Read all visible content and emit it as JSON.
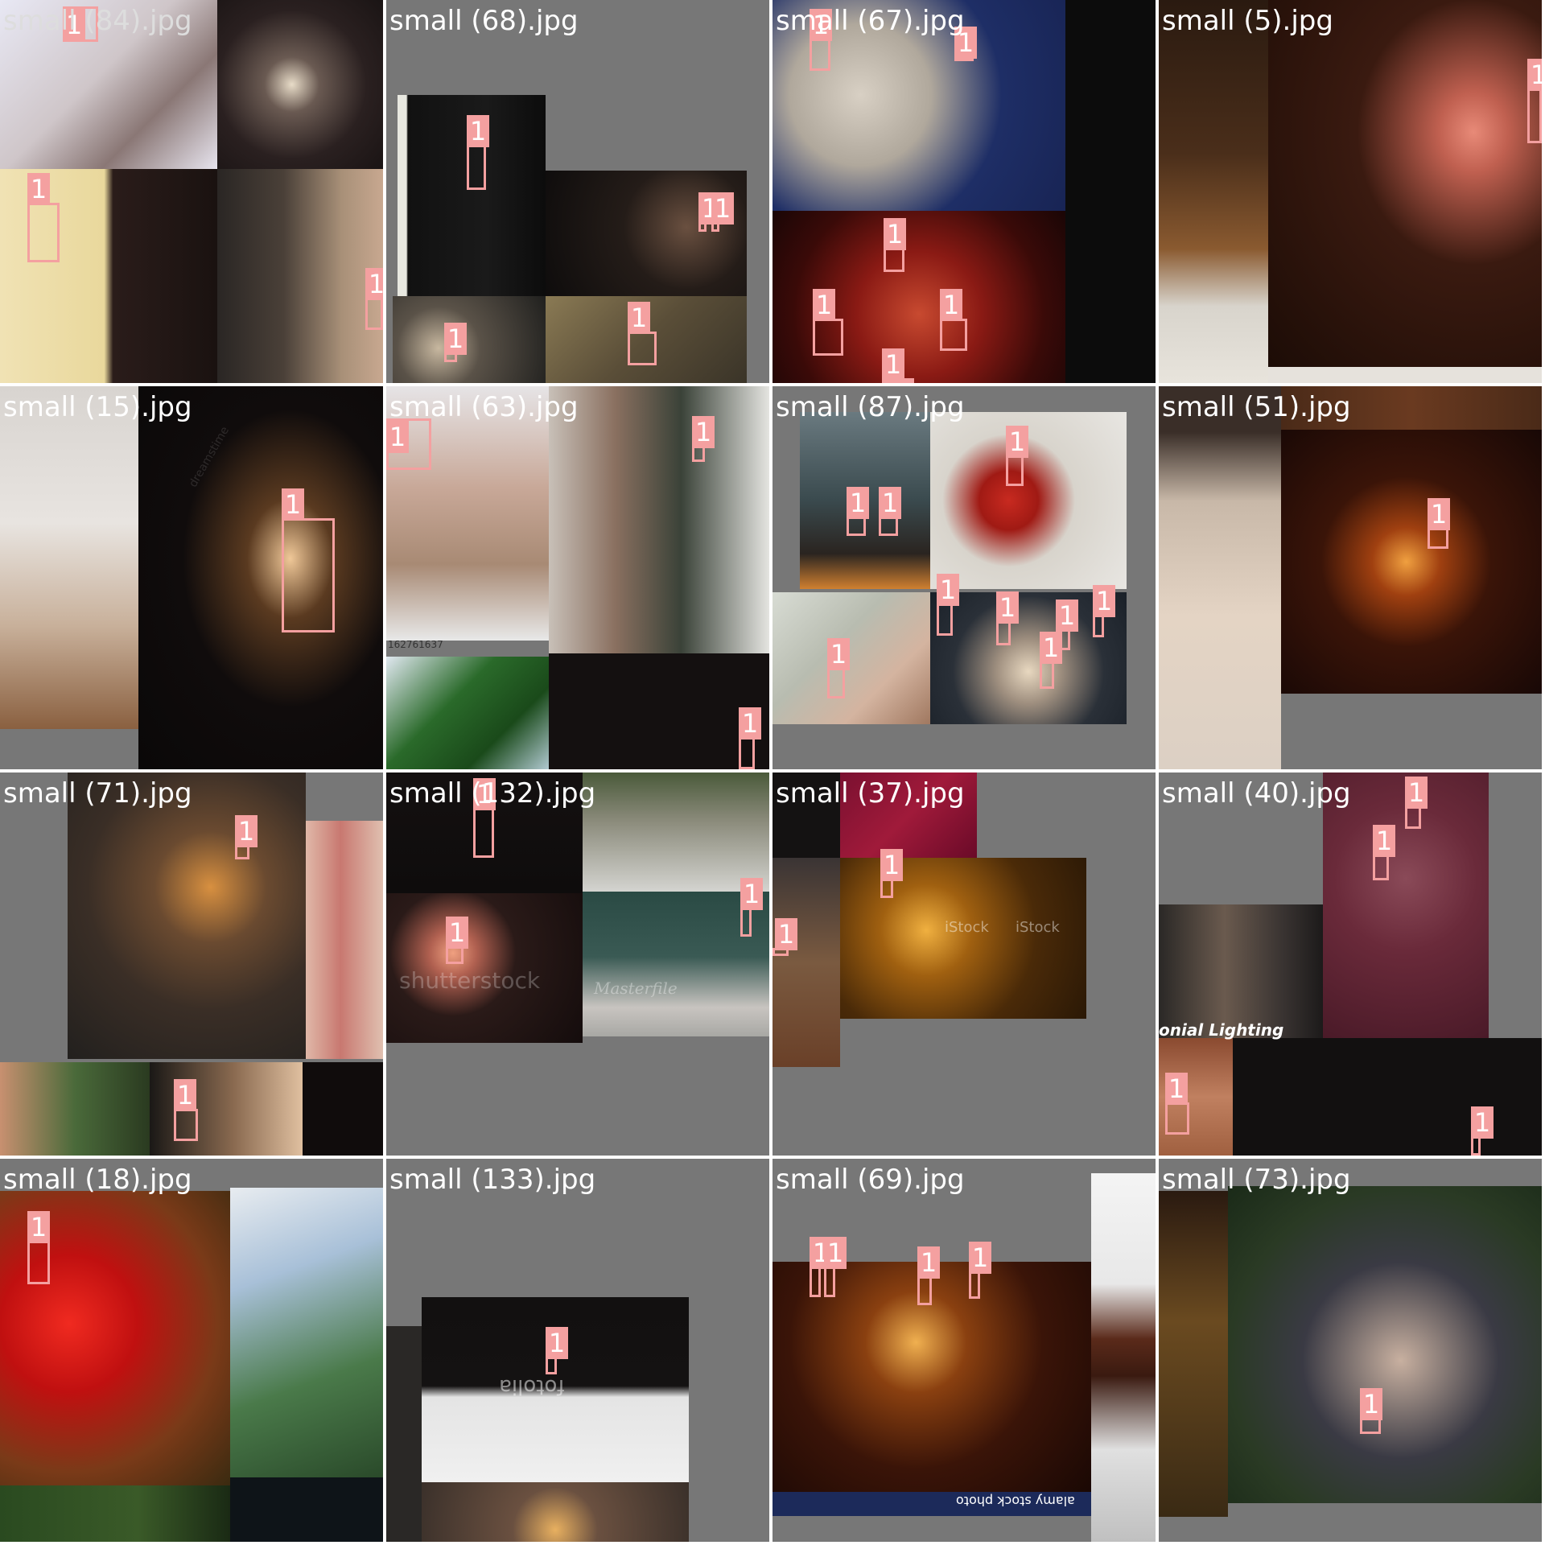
{
  "detection_label": "1",
  "tiles": [
    {
      "caption": "small (84).jpg"
    },
    {
      "caption": "small (68).jpg"
    },
    {
      "caption": "small (67).jpg"
    },
    {
      "caption": "small (5).jpg"
    },
    {
      "caption": "small (15).jpg"
    },
    {
      "caption": "small (63).jpg"
    },
    {
      "caption": "small (87).jpg"
    },
    {
      "caption": "small (51).jpg"
    },
    {
      "caption": "small (71).jpg"
    },
    {
      "caption": "small (132).jpg"
    },
    {
      "caption": "small (37).jpg"
    },
    {
      "caption": "small (40).jpg"
    },
    {
      "caption": "small (18).jpg"
    },
    {
      "caption": "small (133).jpg"
    },
    {
      "caption": "small (69).jpg"
    },
    {
      "caption": "small (73).jpg"
    }
  ],
  "watermarks": {
    "shutterstock": "shutterstock",
    "istock": "iStock",
    "dreamstime": "dreamstime",
    "fotolia": "fotolia",
    "alamy": "alamy stock photo",
    "masterfile": "Masterfile",
    "lighting": "onial Lighting",
    "stock_id": "162761637"
  }
}
